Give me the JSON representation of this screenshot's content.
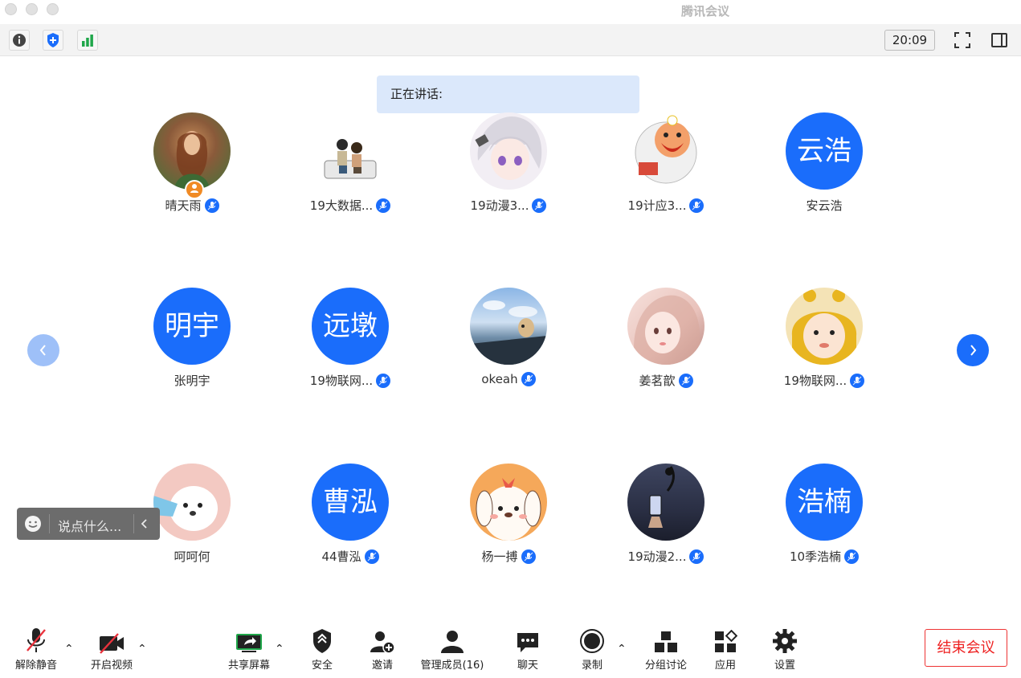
{
  "window": {
    "title": "腾讯会议"
  },
  "top_toolbar": {
    "time": "20:09"
  },
  "speaking": {
    "label": "正在讲话:"
  },
  "participants": [
    {
      "name": "晴天雨",
      "mic": true,
      "host": true
    },
    {
      "name": "19大数据...",
      "mic": true
    },
    {
      "name": "19动漫3...",
      "mic": true
    },
    {
      "name": "19计应3...",
      "mic": true
    },
    {
      "name": "安云浩",
      "mic": false,
      "avatar_text": "云浩"
    },
    {
      "name": "张明宇",
      "mic": false,
      "avatar_text": "明宇"
    },
    {
      "name": "19物联网...",
      "mic": true,
      "avatar_text": "远墩"
    },
    {
      "name": "okeah",
      "mic": true
    },
    {
      "name": "姜茗歆",
      "mic": true
    },
    {
      "name": "19物联网...",
      "mic": true
    },
    {
      "name": "呵呵何",
      "mic": false
    },
    {
      "name": "44曹泓",
      "mic": true,
      "avatar_text": "曹泓"
    },
    {
      "name": "杨一搏",
      "mic": true
    },
    {
      "name": "19动漫2...",
      "mic": true
    },
    {
      "name": "10季浩楠",
      "mic": true,
      "avatar_text": "浩楠"
    }
  ],
  "chat_input": {
    "placeholder": "说点什么..."
  },
  "bottom_bar": {
    "unmute": "解除静音",
    "video": "开启视频",
    "share": "共享屏幕",
    "security": "安全",
    "invite": "邀请",
    "members": "管理成员(16)",
    "chat": "聊天",
    "record": "录制",
    "breakout": "分组讨论",
    "apps": "应用",
    "settings": "设置",
    "end": "结束会议"
  },
  "colors": {
    "accent": "#1a6dfb",
    "end": "#e22222",
    "share_green": "#1fa64a"
  }
}
